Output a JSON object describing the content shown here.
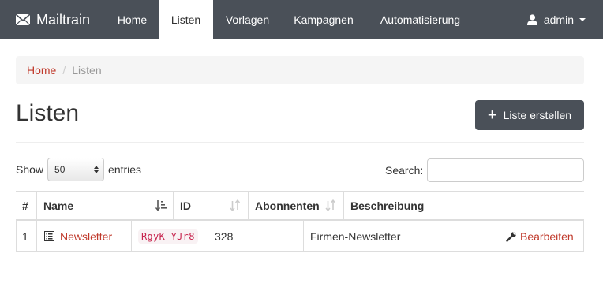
{
  "navbar": {
    "brand": "Mailtrain",
    "items": [
      {
        "label": "Home"
      },
      {
        "label": "Listen"
      },
      {
        "label": "Vorlagen"
      },
      {
        "label": "Kampagnen"
      },
      {
        "label": "Automatisierung"
      }
    ],
    "active_item": "Listen",
    "user": "admin"
  },
  "breadcrumb": {
    "home": "Home",
    "current": "Listen"
  },
  "page": {
    "title": "Listen",
    "create_button": "Liste erstellen"
  },
  "controls": {
    "show_label": "Show",
    "entries_value": "50",
    "entries_label": "entries",
    "search_label": "Search:",
    "search_value": ""
  },
  "table": {
    "columns": [
      "#",
      "Name",
      "ID",
      "Abonnenten",
      "Beschreibung"
    ],
    "rows": [
      {
        "index": "1",
        "name": "Newsletter",
        "id": "RgyK-YJr8",
        "subscribers": "328",
        "description": "Firmen-Newsletter",
        "action": "Bearbeiten"
      }
    ]
  },
  "colors": {
    "navbar_bg": "#4a5058",
    "link": "#c0392b",
    "code_text": "#c7254e",
    "code_bg": "#f9f2f4"
  }
}
